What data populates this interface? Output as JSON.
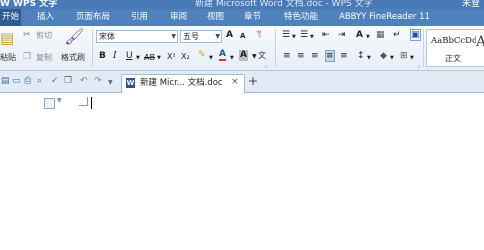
{
  "titlebar": {
    "app_title": "W WPS 文字",
    "doc_title": "新建 Microsoft Word 文档.doc - WPS 文字",
    "right_text": "未登"
  },
  "menu": {
    "tabs": [
      {
        "label": "开始",
        "active": true
      },
      {
        "label": "插入"
      },
      {
        "label": "页面布局"
      },
      {
        "label": "引用"
      },
      {
        "label": "审阅"
      },
      {
        "label": "视图"
      },
      {
        "label": "章节"
      },
      {
        "label": "特色功能"
      },
      {
        "label": "ABBYY FineReader 11"
      }
    ]
  },
  "ribbon": {
    "clipboard": {
      "paste_label": "粘贴",
      "cut_label": "剪切",
      "copy_label": "复制",
      "format_painter_label": "格式刷"
    },
    "font": {
      "font_name": "宋体",
      "font_size": "五号",
      "grow_label": "A",
      "shrink_label": "A",
      "clear_label": "ꔳ",
      "bold": "B",
      "italic": "I",
      "underline": "U",
      "strikethrough": "AB",
      "superscript": "X²",
      "subscript": "X₂",
      "font_color_label": "A",
      "char_shading_label": "A",
      "phonetic_label": "文"
    },
    "paragraph": {
      "bullets": "☰",
      "numbering": "☰",
      "decrease_indent": "⇤",
      "increase_indent": "⇥",
      "chinese_layout": "A",
      "sort": "A↓",
      "show_marks": "↵",
      "align_left": "≡",
      "align_center": "≡",
      "align_right": "≡",
      "justify": "≡",
      "distributed": "≡",
      "line_spacing": "↕",
      "shading": "◆",
      "borders": "⊞"
    },
    "styles": {
      "sample": "AaBbCcDd",
      "current": "正文",
      "next_sample": "A"
    }
  },
  "tabbar": {
    "doc_tab_label": "新建 Micr... 文档.doc",
    "close_symbol": "×",
    "new_tab_symbol": "+"
  },
  "colors": {
    "title_bar": "#4a79b8",
    "menu_bar": "#4f81bd",
    "active_tab": "#2f5b93",
    "ribbon_bg": "#eef3fa",
    "document_bg": "#ffffff"
  }
}
